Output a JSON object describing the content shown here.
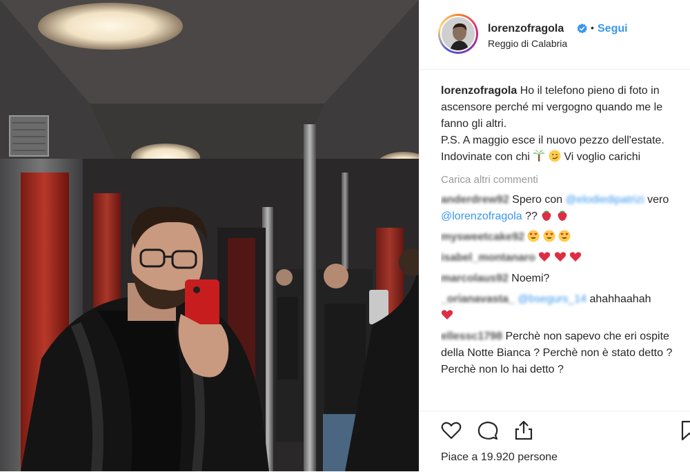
{
  "post": {
    "username": "lorenzofragola",
    "follow_label": "Segui",
    "separator": "•",
    "location": "Reggio di Calabria",
    "caption": {
      "username": "lorenzofragola",
      "line1": "Ho il telefono pieno di foto in ascensore perché mi vergogno quando me le fanno gli altri.",
      "line2": "P.S. A maggio esce il nuovo pezzo dell'estate. Indovinate con chi",
      "line2_end": "Vi voglio carichi"
    },
    "load_more_label": "Carica altri commenti",
    "comments": [
      {
        "user": "anderdrew92",
        "text_before": "Spero con",
        "mention1": "@elodiedipatrizi",
        "text_mid": "vero",
        "mention2": "@lorenzofragola",
        "text_after": "??"
      },
      {
        "user": "mysweetcake92",
        "text": ""
      },
      {
        "user": "isabel_montanaro",
        "text": ""
      },
      {
        "user": "marcolaus92",
        "text": "Noemi?"
      },
      {
        "user": "_orianavasta_",
        "mention": "@bsegurs_14",
        "text": "ahahhaahah"
      },
      {
        "user": "ellessc1798",
        "text": "Perchè non sapevo che eri ospite della Notte Bianca ? Perchè non è stato detto ? Perchè non lo hai detto ?"
      }
    ],
    "likes_text": "Piace a 19.920 persone",
    "icons": {
      "like": "heart-icon",
      "comment": "comment-icon",
      "share": "share-icon",
      "save": "bookmark-icon",
      "verified": "verified-badge-icon"
    },
    "colors": {
      "link": "#3897f0",
      "muted": "#999999",
      "text": "#262626"
    }
  }
}
